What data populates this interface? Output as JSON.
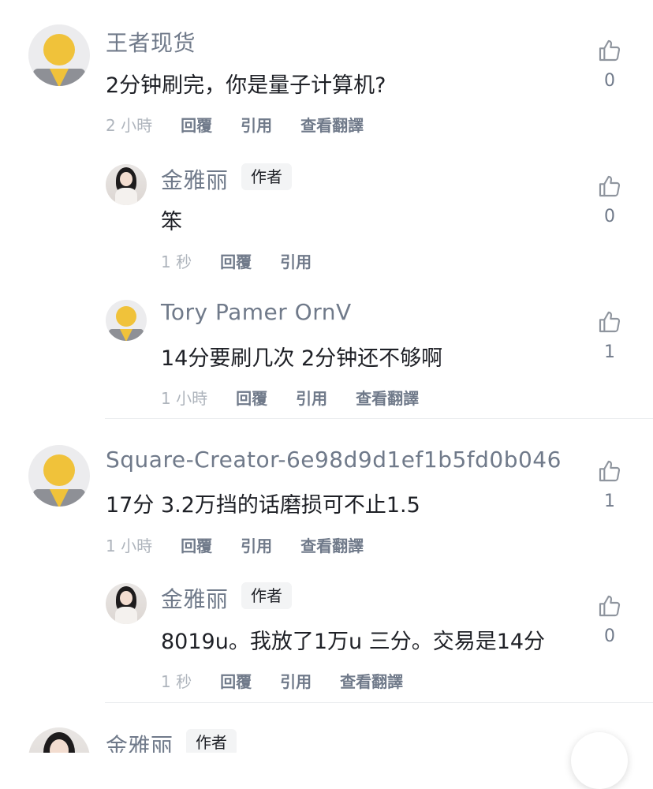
{
  "comments": [
    {
      "author": "王者现货",
      "text": "2分钟刷完，你是量子计算机?",
      "time": "2 小時",
      "actions": [
        "回覆",
        "引用",
        "查看翻譯"
      ],
      "likes": "0",
      "avatar": "default-avatar"
    },
    {
      "author": "金雅丽",
      "badge": "作者",
      "text": "笨",
      "time": "1 秒",
      "actions": [
        "回覆",
        "引用"
      ],
      "likes": "0",
      "avatar": "photo-avatar"
    },
    {
      "author": "Tory Pamer OrnV",
      "text": "14分要刷几次 2分钟还不够啊",
      "time": "1 小時",
      "actions": [
        "回覆",
        "引用",
        "查看翻譯"
      ],
      "likes": "1",
      "avatar": "default-avatar"
    },
    {
      "author": "Square-Creator-6e98d9d1ef1b5fd0b046",
      "text": "17分 3.2万挡的话磨损可不止1.5",
      "time": "1 小時",
      "actions": [
        "回覆",
        "引用",
        "查看翻譯"
      ],
      "likes": "1",
      "avatar": "default-avatar"
    },
    {
      "author": "金雅丽",
      "badge": "作者",
      "text": "8019u。我放了1万u 三分。交易是14分",
      "time": "1 秒",
      "actions": [
        "回覆",
        "引用",
        "查看翻譯"
      ],
      "likes": "0",
      "avatar": "photo-avatar"
    },
    {
      "author": "金雅丽",
      "badge": "作者",
      "avatar": "photo-avatar"
    }
  ],
  "icons": {
    "like": "thumbs-up-icon"
  },
  "colors": {
    "default_avatar_head": "#f0c23a",
    "default_avatar_body": "#8e9096",
    "muted_text": "#707a8a",
    "primary_text": "#1e2026"
  }
}
